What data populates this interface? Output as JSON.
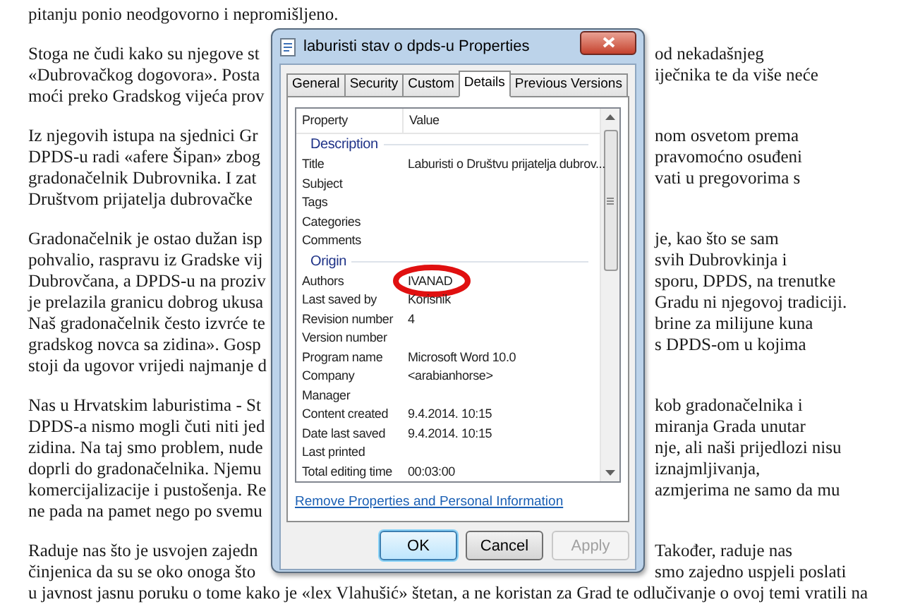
{
  "document": {
    "paragraphs": [
      {
        "lines": [
          {
            "kind": "full",
            "text": "pitanju ponio neodgovorno i nepromišljeno."
          }
        ]
      },
      {
        "lines": [
          {
            "kind": "split",
            "left": "Stoga ne čudi kako su njegove st",
            "right": "od nekadašnjeg"
          },
          {
            "kind": "split",
            "left": "«Dubrovačkog dogovora». Posta",
            "right": "iječnika te da više neće"
          },
          {
            "kind": "split",
            "left": "moći preko Gradskog vijeća prov"
          }
        ]
      },
      {
        "lines": [
          {
            "kind": "split",
            "left": "Iz njegovih istupa  na sjednici Gr",
            "right": "nom osvetom prema"
          },
          {
            "kind": "split",
            "left": "DPDS-u radi «afere Šipan» zbog",
            "right": "pravomoćno osuđeni"
          },
          {
            "kind": "split",
            "left": "gradonačelnik Dubrovnika. I zat",
            "right": "vati u pregovorima s"
          },
          {
            "kind": "split",
            "left": "Društvom prijatelja dubrovačke"
          }
        ]
      },
      {
        "lines": [
          {
            "kind": "split",
            "left": "Gradonačelnik je ostao dužan isp",
            "right": "je, kao što se sam"
          },
          {
            "kind": "split",
            "left": "pohvalio, raspravu iz Gradske vij",
            "right": "svih Dubrovkinja i"
          },
          {
            "kind": "split",
            "left": "Dubrovčana, a DPDS-u na proziv",
            "right": "sporu, DPDS, na trenutke"
          },
          {
            "kind": "split",
            "left": "je prelazila granicu dobrog ukusa",
            "right": "Gradu ni njegovoj tradiciji."
          },
          {
            "kind": "split",
            "left": "Naš gradonačelnik često izvrće te",
            "right": "brine za milijune kuna"
          },
          {
            "kind": "split",
            "left": "gradskog novca sa zidina». Gosp",
            "right": "s DPDS-om u kojima"
          },
          {
            "kind": "split",
            "left": "stoji da ugovor vrijedi najmanje d"
          }
        ]
      },
      {
        "lines": [
          {
            "kind": "split",
            "left": "Nas u Hrvatskim laburistima - St",
            "right": "kob gradonačelnika i"
          },
          {
            "kind": "split",
            "left": "DPDS-a nismo mogli čuti niti jed",
            "right": "miranja Grada unutar"
          },
          {
            "kind": "split",
            "left": "zidina. Na taj smo problem, nude",
            "right": "nje, ali naši prijedlozi nisu"
          },
          {
            "kind": "split",
            "left": "doprli do gradonačelnika. Njemu",
            "right": "iznajmljivanja,"
          },
          {
            "kind": "split",
            "left": "komercijalizacije i pustošenja. Re",
            "right": "azmjerima ne samo da mu"
          },
          {
            "kind": "split",
            "left": "ne pada na pamet nego po svemu"
          }
        ]
      },
      {
        "lines": [
          {
            "kind": "split",
            "left": "Raduje nas što je usvojen zajedn",
            "right": "Također, raduje nas"
          },
          {
            "kind": "split",
            "left": "činjenica da su se oko onoga što",
            "right": "smo zajedno uspjeli poslati"
          },
          {
            "kind": "full",
            "text": "u javnost jasnu poruku o tome kako je «lex Vlahušić» štetan, a ne koristan za Grad te odlučivanje o ovoj temi vratili na"
          }
        ]
      }
    ]
  },
  "dialog": {
    "title": "laburisti stav o dpds-u Properties",
    "tabs": [
      {
        "label": "General",
        "selected": false
      },
      {
        "label": "Security",
        "selected": false
      },
      {
        "label": "Custom",
        "selected": false
      },
      {
        "label": "Details",
        "selected": true
      },
      {
        "label": "Previous Versions",
        "selected": false
      }
    ],
    "columns": [
      "Property",
      "Value"
    ],
    "groups": [
      {
        "heading": "Description",
        "rows": [
          {
            "property": "Title",
            "value": "Laburisti o Društvu prijatelja dubrov...",
            "circled": false
          },
          {
            "property": "Subject",
            "circled": false
          },
          {
            "property": "Tags",
            "circled": false
          },
          {
            "property": "Categories",
            "circled": false
          },
          {
            "property": "Comments",
            "circled": false
          }
        ]
      },
      {
        "heading": "Origin",
        "rows": [
          {
            "property": "Authors",
            "value": "IVANAD",
            "circled": true
          },
          {
            "property": "Last saved by",
            "value": "Korisnik",
            "circled": false
          },
          {
            "property": "Revision number",
            "value": "4",
            "circled": false
          },
          {
            "property": "Version number",
            "circled": false
          },
          {
            "property": "Program name",
            "value": "Microsoft Word 10.0",
            "circled": false
          },
          {
            "property": "Company",
            "value": "<arabianhorse>",
            "circled": false
          },
          {
            "property": "Manager",
            "circled": false
          },
          {
            "property": "Content created",
            "value": "9.4.2014. 10:15",
            "circled": false
          },
          {
            "property": "Date last saved",
            "value": "9.4.2014. 10:15",
            "circled": false
          },
          {
            "property": "Last printed",
            "circled": false
          },
          {
            "property": "Total editing time",
            "value": "00:03:00",
            "circled": false
          }
        ]
      }
    ],
    "link": "Remove Properties and Personal Information",
    "buttons": [
      {
        "label": "OK",
        "default": true,
        "disabled": false
      },
      {
        "label": "Cancel",
        "default": false,
        "disabled": false
      },
      {
        "label": "Apply",
        "default": false,
        "disabled": true
      }
    ]
  }
}
